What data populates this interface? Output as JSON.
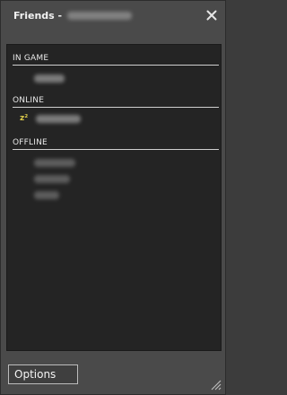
{
  "window": {
    "title": "Friends -",
    "close_icon": "close-icon"
  },
  "sections": [
    {
      "label": "IN GAME",
      "friends": [
        {
          "status": "in-game"
        }
      ]
    },
    {
      "label": "ONLINE",
      "friends": [
        {
          "status": "away",
          "status_icon": "z²"
        }
      ]
    },
    {
      "label": "OFFLINE",
      "friends": [
        {
          "status": "offline"
        },
        {
          "status": "offline"
        },
        {
          "status": "offline"
        }
      ]
    }
  ],
  "footer": {
    "options_label": "Options"
  },
  "colors": {
    "window_bg": "#4a4a4a",
    "list_bg": "#242424",
    "header_line": "#cfcfcf",
    "away_icon": "#d9c84a"
  }
}
